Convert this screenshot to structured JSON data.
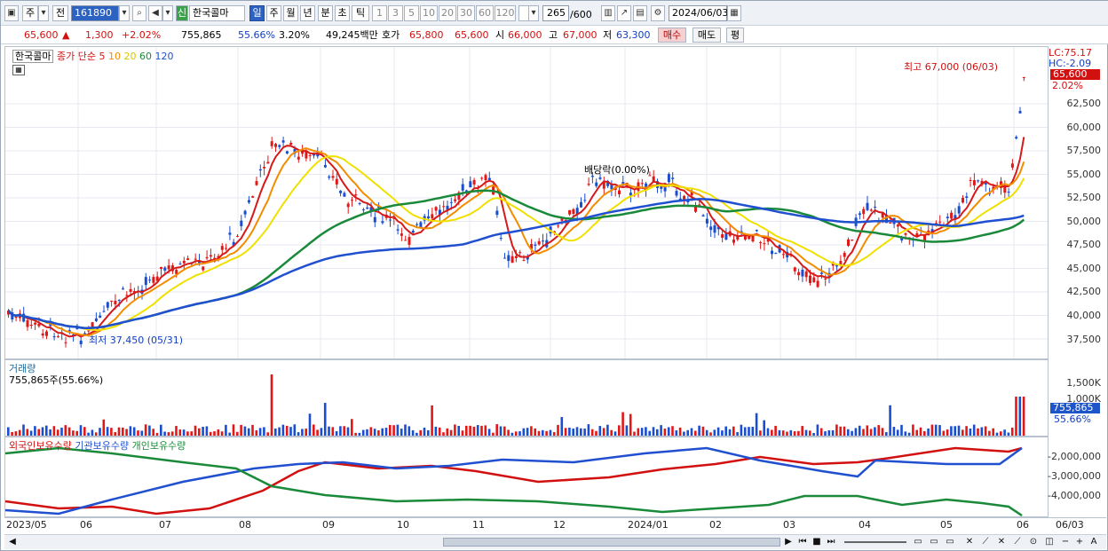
{
  "toolbar": {
    "period_main": "주",
    "prev_btn": "전",
    "code": "161890",
    "badge": "신",
    "stock_name": "한국콜마",
    "periods": [
      "일",
      "주",
      "월",
      "년",
      "분",
      "초",
      "틱"
    ],
    "period_selected": "일",
    "intervals": [
      "1",
      "3",
      "5",
      "10",
      "20",
      "30",
      "60",
      "120"
    ],
    "count": "265",
    "count_total": "/600",
    "date": "2024/06/03"
  },
  "quote": {
    "price": "65,600",
    "arrow": "▲",
    "change": "1,300",
    "change_pct": "+2.02%",
    "volume": "755,865",
    "volume_ratio": "55.66%",
    "turnover": "3.20%",
    "amount": "49,245백만",
    "bid_ask_label": "호가",
    "ask": "65,800",
    "bid": "65,600",
    "open_label": "시",
    "open": "66,000",
    "high_label": "고",
    "high": "67,000",
    "low_label": "저",
    "low": "63,300",
    "buy_btn": "매수",
    "sell_btn": "매도",
    "avg_btn": "평"
  },
  "price_pane": {
    "name": "한국콜마",
    "legend_prefix": "종가 단순",
    "ma_labels": [
      "5",
      "10",
      "20",
      "60",
      "120"
    ],
    "ma_colors": [
      "#d61a1a",
      "#f28c00",
      "#f0e000",
      "#1a8a3a",
      "#2050d0"
    ],
    "high_note": "최고 67,000 (06/03)",
    "low_note": "최저 37,450 (05/31)",
    "dividend_note": "배당락(0.00%)",
    "lc": "LC:75.17",
    "hc": "HC:-2.09",
    "current_tag": "65,600",
    "current_pct": "2.02%",
    "y_ticks": [
      "62,500",
      "60,000",
      "57,500",
      "55,000",
      "52,500",
      "50,000",
      "47,500",
      "45,000",
      "42,500",
      "40,000",
      "37,500"
    ]
  },
  "volume_pane": {
    "title": "거래량",
    "value": "755,865주(55.66%)",
    "y_ticks": [
      "1,500K",
      "1,000K"
    ],
    "current_tag": "755,865",
    "current_pct": "55.66%"
  },
  "holding_pane": {
    "legend": [
      "외국인보유수량",
      "기관보유수량",
      "개인보유수량"
    ],
    "y_ticks": [
      "-2,000,000",
      "-3,000,000",
      "-4,000,000"
    ]
  },
  "x_axis": [
    "2023/05",
    "06",
    "07",
    "08",
    "09",
    "10",
    "11",
    "12",
    "2024/01",
    "02",
    "03",
    "04",
    "05",
    "06",
    "06/03"
  ]
}
